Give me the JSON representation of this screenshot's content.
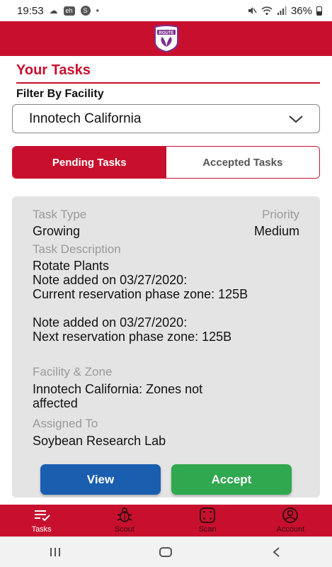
{
  "status_bar": {
    "time": "19:53",
    "battery": "36%",
    "notif_icons": [
      "cloud-icon",
      "eh-badge-icon",
      "s-circle-icon",
      "dot-icon"
    ],
    "system_icons": [
      "mute-icon",
      "wifi-icon",
      "signal-icon",
      "battery-icon"
    ]
  },
  "header": {
    "logo_text": "ROUTE",
    "brand_color": "#c8102e"
  },
  "page": {
    "title": "Your Tasks",
    "filter_label": "Filter By Facility",
    "facility_selected": "Innotech California"
  },
  "tabs": [
    {
      "label": "Pending Tasks",
      "active": true
    },
    {
      "label": "Accepted Tasks",
      "active": false
    }
  ],
  "task": {
    "type_label": "Task Type",
    "type_value": "Growing",
    "priority_label": "Priority",
    "priority_value": "Medium",
    "description_label": "Task Description",
    "description_value": "Rotate Plants\nNote added on 03/27/2020:\nCurrent reservation phase zone: 125B\n\nNote added on 03/27/2020:\nNext reservation phase zone: 125B",
    "facility_label": "Facility & Zone",
    "facility_value": "Innotech California: Zones not\naffected",
    "assigned_label": "Assigned To",
    "assigned_value": "Soybean Research Lab",
    "view_label": "View",
    "accept_label": "Accept"
  },
  "bottom_nav": [
    {
      "label": "Tasks",
      "icon": "tasks-icon",
      "active": true
    },
    {
      "label": "Scout",
      "icon": "bug-icon",
      "active": false
    },
    {
      "label": "Scan",
      "icon": "scan-icon",
      "active": false
    },
    {
      "label": "Account",
      "icon": "account-icon",
      "active": false
    }
  ],
  "colors": {
    "primary": "#c8102e",
    "view_button": "#1a5eb0",
    "accept_button": "#2fa84f",
    "card_bg": "#e4e4e4"
  }
}
